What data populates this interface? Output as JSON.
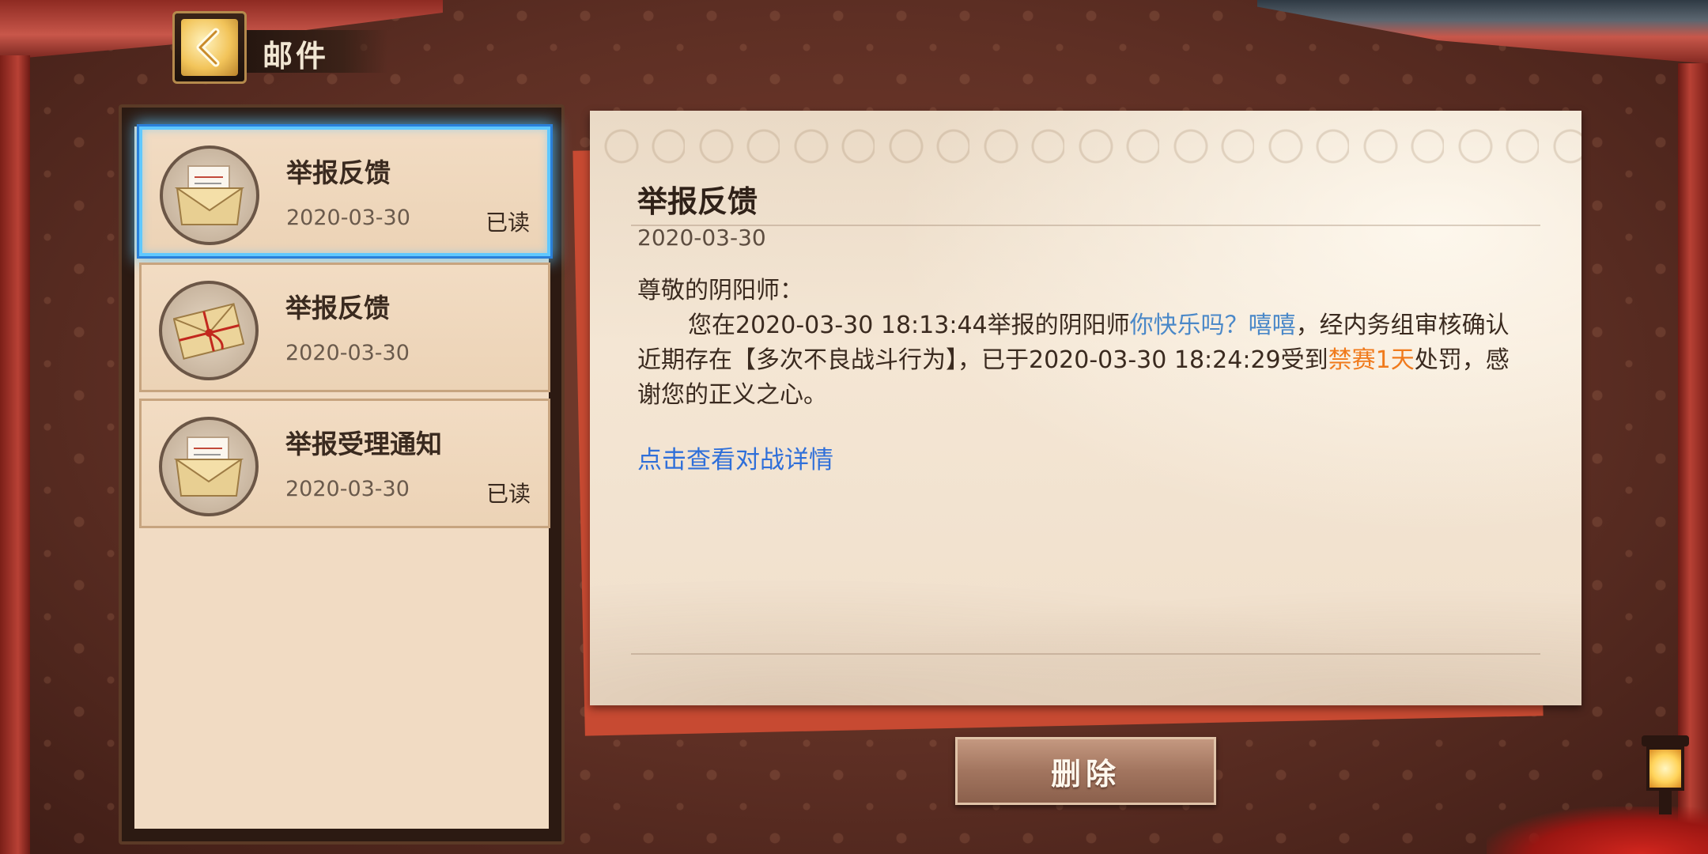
{
  "header": {
    "title": "邮件",
    "back_icon": "chevron-left-icon"
  },
  "mail_list": [
    {
      "title": "举报反馈",
      "date": "2020-03-30",
      "status": "已读",
      "icon": "open-envelope-icon",
      "selected": true
    },
    {
      "title": "举报反馈",
      "date": "2020-03-30",
      "status": "",
      "icon": "sealed-envelope-icon",
      "selected": false
    },
    {
      "title": "举报受理通知",
      "date": "2020-03-30",
      "status": "已读",
      "icon": "open-envelope-icon",
      "selected": false
    }
  ],
  "detail": {
    "title": "举报反馈",
    "date": "2020-03-30",
    "greeting": "尊敬的阴阳师：",
    "body_part1": "您在2020-03-30 18:13:44举报的阴阳师",
    "player_name": "你快乐吗？嘻嘻",
    "body_part2": "，经内务组审核确认近期存在【多次不良战斗行为】，已于2020-03-30 18:24:29受到",
    "penalty": "禁赛1天",
    "body_part3": "处罚，感谢您的正义之心。",
    "link_text": "点击查看对战详情"
  },
  "actions": {
    "delete_label": "删除"
  },
  "colors": {
    "selected_glow": "#5fc8ff",
    "player_name": "#4a88c8",
    "penalty": "#f07a1c",
    "link": "#2f6fd9"
  }
}
